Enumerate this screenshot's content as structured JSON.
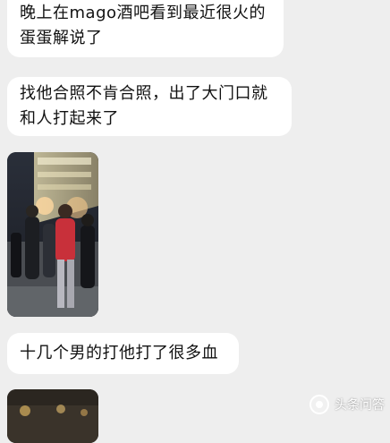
{
  "messages": [
    {
      "lines": [
        "晚上在mago酒吧看到最近很火的",
        "蛋蛋解说了"
      ]
    },
    {
      "lines": [
        "找他合照不肯合照，出了大门口就",
        "和人打起来了"
      ]
    },
    {
      "lines": [
        "十几个男的打他打了很多血"
      ]
    }
  ],
  "watermark": {
    "text": "头条问答",
    "icon": "toutiao-logo-icon"
  },
  "colors": {
    "background": "#eeeeee",
    "bubble": "#ffffff",
    "text": "#111111"
  }
}
